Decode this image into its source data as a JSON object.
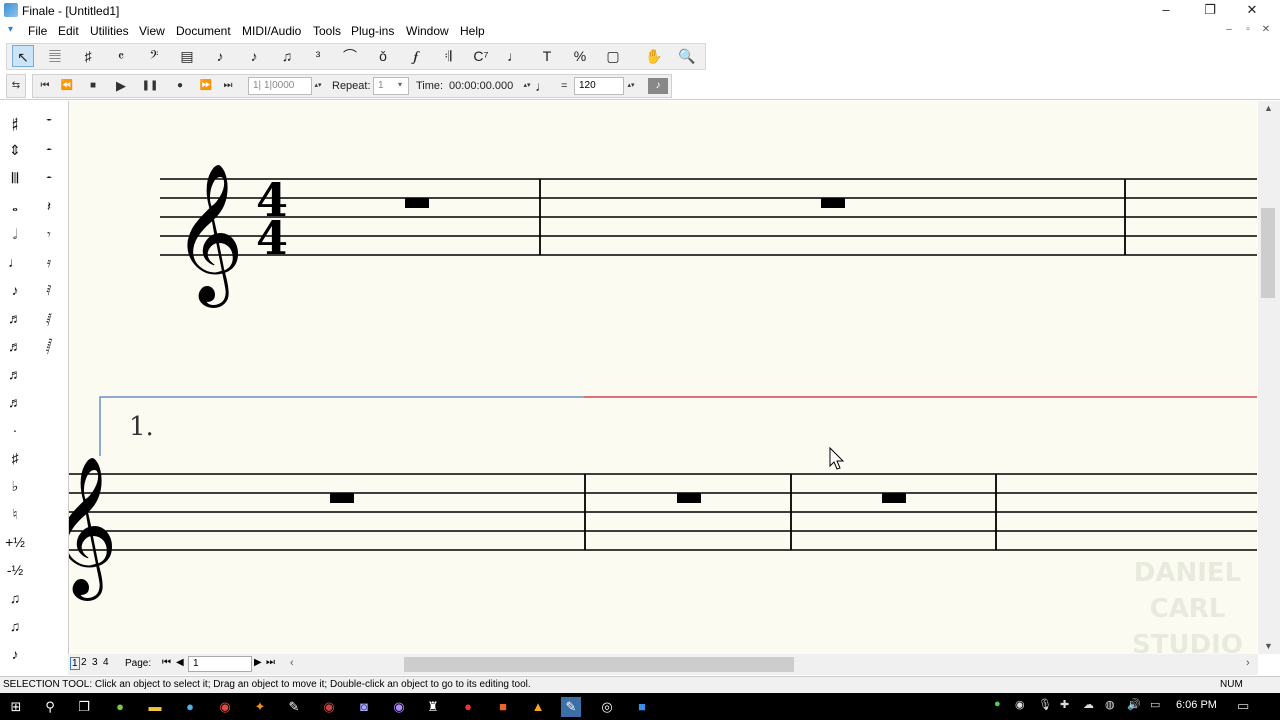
{
  "window": {
    "title": "Finale - [Untitled1]",
    "minimize": "–",
    "restore": "❐",
    "close": "✕"
  },
  "menu": [
    "File",
    "Edit",
    "Utilities",
    "View",
    "Document",
    "MIDI/Audio",
    "Tools",
    "Plug-ins",
    "Window",
    "Help"
  ],
  "mdi": {
    "minimize": "–",
    "restore": "▫",
    "close": "✕"
  },
  "main_tools": [
    {
      "name": "selection-tool",
      "glyph": "↖"
    },
    {
      "name": "staff-tool",
      "glyph": "𝄚"
    },
    {
      "name": "key-signature-tool",
      "glyph": "♯"
    },
    {
      "name": "time-signature-tool",
      "glyph": "𝄴"
    },
    {
      "name": "clef-tool",
      "glyph": "𝄢"
    },
    {
      "name": "measure-tool",
      "glyph": "▤"
    },
    {
      "name": "simple-entry-tool",
      "glyph": "♪"
    },
    {
      "name": "speedy-entry-tool",
      "glyph": "♪"
    },
    {
      "name": "hyperscribe-tool",
      "glyph": "♫"
    },
    {
      "name": "tuplet-tool",
      "glyph": "³"
    },
    {
      "name": "smart-shape-tool",
      "glyph": "⌒"
    },
    {
      "name": "articulation-tool",
      "glyph": "ǒ"
    },
    {
      "name": "expression-tool",
      "glyph": "𝆑"
    },
    {
      "name": "repeat-tool",
      "glyph": "𝄇"
    },
    {
      "name": "chord-tool",
      "glyph": "C⁷"
    },
    {
      "name": "lyrics-tool",
      "glyph": "♩"
    },
    {
      "name": "text-tool",
      "glyph": "T"
    },
    {
      "name": "resize-tool",
      "glyph": "%"
    },
    {
      "name": "page-layout-tool",
      "glyph": "▢"
    },
    {
      "name": "hand-grabber-tool",
      "glyph": "✋"
    },
    {
      "name": "zoom-tool",
      "glyph": "🔍"
    }
  ],
  "playback": {
    "position": "1| 1|0000",
    "repeat_label": "Repeat:",
    "repeat_value": "1",
    "time_label": "Time:",
    "time_value": "00:00:00.000",
    "equals": "=",
    "tempo": "120"
  },
  "palette_left": [
    "𝄰",
    "⇕",
    "𝄃𝄂",
    "𝅝",
    "𝅗𝅥",
    "♩",
    "♪",
    "♬",
    "♬",
    "♬",
    "♬",
    "·",
    "♯",
    "♭",
    "♮",
    "+½",
    "-½",
    "♫",
    "♫",
    "♪"
  ],
  "palette_right": [
    "𝄻",
    "𝄼",
    "𝄼",
    "𝄽",
    "𝄾",
    "𝄿",
    "𝅀",
    "𝅁",
    "𝅂"
  ],
  "score": {
    "time_signature_top": "4",
    "time_signature_bottom": "4",
    "ending_number": "1."
  },
  "pages": {
    "tabs": [
      "1",
      "2",
      "3",
      "4"
    ],
    "label": "Page:",
    "value": "1"
  },
  "status": {
    "text": "SELECTION TOOL: Click an object to select it; Drag an object to move it; Double-click an object to go to its editing tool.",
    "num": "NUM"
  },
  "watermark": [
    "DANIEL",
    "CARL",
    "STUDIO"
  ],
  "clock": "6:06 PM",
  "colors": {
    "workspace": "#fcfbf2",
    "ending_blue": "#6a8fc7",
    "ending_red": "#d4424f"
  }
}
